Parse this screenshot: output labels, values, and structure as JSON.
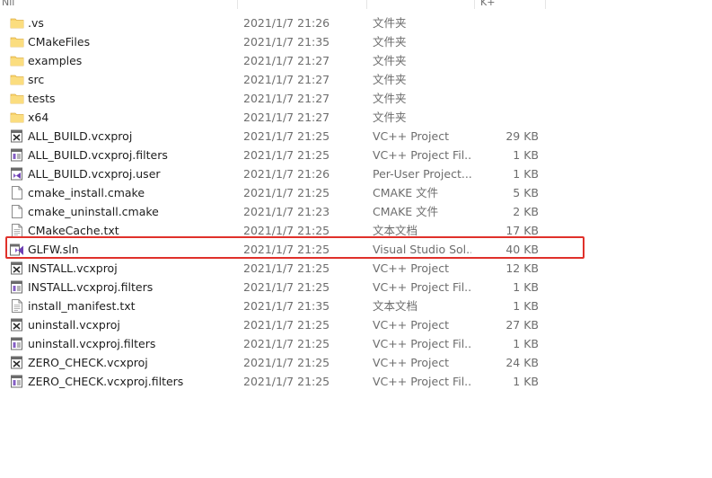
{
  "header": {
    "columns": [
      "Nil",
      "",
      "",
      "",
      "K+"
    ]
  },
  "files": [
    {
      "name": ".vs",
      "date": "2021/1/7 21:26",
      "type": "文件夹",
      "size": "",
      "icon": "folder-icon"
    },
    {
      "name": "CMakeFiles",
      "date": "2021/1/7 21:35",
      "type": "文件夹",
      "size": "",
      "icon": "folder-icon"
    },
    {
      "name": "examples",
      "date": "2021/1/7 21:27",
      "type": "文件夹",
      "size": "",
      "icon": "folder-icon"
    },
    {
      "name": "src",
      "date": "2021/1/7 21:27",
      "type": "文件夹",
      "size": "",
      "icon": "folder-icon"
    },
    {
      "name": "tests",
      "date": "2021/1/7 21:27",
      "type": "文件夹",
      "size": "",
      "icon": "folder-icon"
    },
    {
      "name": "x64",
      "date": "2021/1/7 21:27",
      "type": "文件夹",
      "size": "",
      "icon": "folder-icon"
    },
    {
      "name": "ALL_BUILD.vcxproj",
      "date": "2021/1/7 21:25",
      "type": "VC++ Project",
      "size": "29 KB",
      "icon": "vcxproj-icon"
    },
    {
      "name": "ALL_BUILD.vcxproj.filters",
      "date": "2021/1/7 21:25",
      "type": "VC++ Project Fil...",
      "size": "1 KB",
      "icon": "filters-icon"
    },
    {
      "name": "ALL_BUILD.vcxproj.user",
      "date": "2021/1/7 21:26",
      "type": "Per-User Project...",
      "size": "1 KB",
      "icon": "vs-user-icon"
    },
    {
      "name": "cmake_install.cmake",
      "date": "2021/1/7 21:25",
      "type": "CMAKE 文件",
      "size": "5 KB",
      "icon": "file-icon"
    },
    {
      "name": "cmake_uninstall.cmake",
      "date": "2021/1/7 21:23",
      "type": "CMAKE 文件",
      "size": "2 KB",
      "icon": "file-icon"
    },
    {
      "name": "CMakeCache.txt",
      "date": "2021/1/7 21:25",
      "type": "文本文档",
      "size": "17 KB",
      "icon": "text-file-icon"
    },
    {
      "name": "GLFW.sln",
      "date": "2021/1/7 21:25",
      "type": "Visual Studio Sol...",
      "size": "40 KB",
      "icon": "sln-icon"
    },
    {
      "name": "INSTALL.vcxproj",
      "date": "2021/1/7 21:25",
      "type": "VC++ Project",
      "size": "12 KB",
      "icon": "vcxproj-icon"
    },
    {
      "name": "INSTALL.vcxproj.filters",
      "date": "2021/1/7 21:25",
      "type": "VC++ Project Fil...",
      "size": "1 KB",
      "icon": "filters-icon"
    },
    {
      "name": "install_manifest.txt",
      "date": "2021/1/7 21:35",
      "type": "文本文档",
      "size": "1 KB",
      "icon": "text-file-icon"
    },
    {
      "name": "uninstall.vcxproj",
      "date": "2021/1/7 21:25",
      "type": "VC++ Project",
      "size": "27 KB",
      "icon": "vcxproj-icon"
    },
    {
      "name": "uninstall.vcxproj.filters",
      "date": "2021/1/7 21:25",
      "type": "VC++ Project Fil...",
      "size": "1 KB",
      "icon": "filters-icon"
    },
    {
      "name": "ZERO_CHECK.vcxproj",
      "date": "2021/1/7 21:25",
      "type": "VC++ Project",
      "size": "24 KB",
      "icon": "vcxproj-icon"
    },
    {
      "name": "ZERO_CHECK.vcxproj.filters",
      "date": "2021/1/7 21:25",
      "type": "VC++ Project Fil...",
      "size": "1 KB",
      "icon": "filters-icon"
    }
  ],
  "highlighted_file": "GLFW.sln",
  "colors": {
    "folder": "#f8d36b",
    "highlight_border": "#e0312b",
    "vs_purple": "#865fc5"
  }
}
